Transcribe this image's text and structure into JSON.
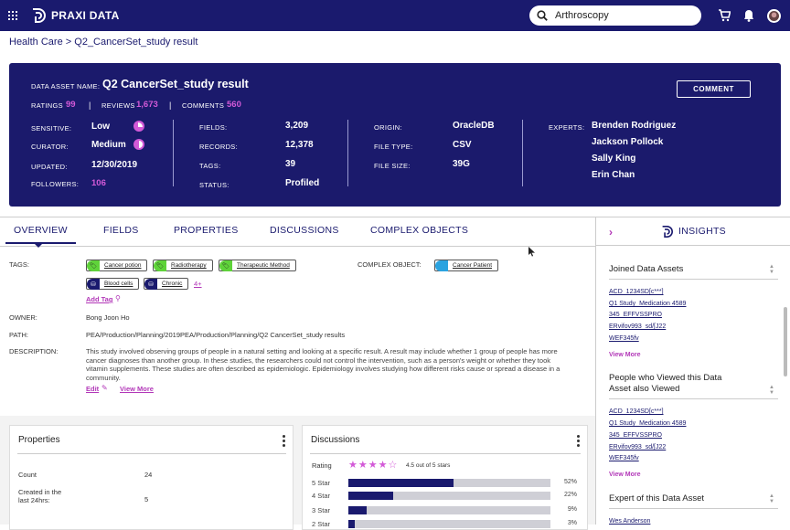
{
  "app": {
    "brand": "PRAXI DATA",
    "search_value": "Arthroscopy"
  },
  "breadcrumb": {
    "root": "Health Care",
    "sep": ">",
    "current": "Q2_CancerSet_study result"
  },
  "asset": {
    "name_label": "DATA ASSET NAME:",
    "name": "Q2 CancerSet_study result",
    "ratings_label": "RATINGS",
    "ratings": "99",
    "reviews_label": "REVIEWS",
    "reviews": "1,673",
    "comments_label": "COMMENTS",
    "comments": "560",
    "sep": "|",
    "comment_button": "COMMENT",
    "col1": {
      "sensitive_label": "SENSITIVE:",
      "sensitive": "Low",
      "curator_label": "CURATOR:",
      "curator": "Medium",
      "updated_label": "UPDATED:",
      "updated": "12/30/2019",
      "followers_label": "FOLLOWERS:",
      "followers": "106"
    },
    "col2": {
      "fields_label": "FIELDS:",
      "fields": "3,209",
      "records_label": "RECORDS:",
      "records": "12,378",
      "tags_label": "TAGS:",
      "tags": "39",
      "status_label": "STATUS:",
      "status": "Profiled"
    },
    "col3": {
      "origin_label": "ORIGIN:",
      "origin": "OracleDB",
      "filetype_label": "FILE TYPE:",
      "filetype": "CSV",
      "filesize_label": "FILE SIZE:",
      "filesize": "39G"
    },
    "experts_label": "EXPERTS:",
    "experts": [
      "Brenden Rodriguez",
      "Jackson Pollock",
      "Sally King",
      "Erin Chan"
    ]
  },
  "tabs": [
    "OVERVIEW",
    "FIELDS",
    "PROPERTIES",
    "DISCUSSIONS",
    "COMPLEX OBJECTS"
  ],
  "overview": {
    "tags_label": "TAGS:",
    "tags": [
      "Cancer potion",
      "Radiotherapy",
      "Therapeutic Method",
      "Blood cells",
      "Chronic"
    ],
    "tags_more": "4+",
    "add_tag": "Add Tag",
    "complex_label": "COMPLEX OBJECT:",
    "complex_object": "Cancer Patient",
    "owner_label": "OWNER:",
    "owner": "Bong Joon Ho",
    "path_label": "PATH:",
    "path": "PEA/Production/Planning/2019PEA/Production/Planning/Q2 CancerSet_study results",
    "description_label": "DESCRIPTION:",
    "description": "This study involved observing groups of people in a natural setting and looking at a specific result. A result may include whether 1 group of people has more cancer diagnoses than another group. In these studies, the researchers could not control the intervention, such as a person's weight or whether they took vitamin supplements. These studies are often described as epidemiologic. Epidemiology involves studying how different risks cause or spread a disease in a community.",
    "edit": "Edit",
    "view_more": "View More"
  },
  "properties_card": {
    "title": "Properties",
    "count_label": "Count",
    "count": "24",
    "created_label": "Created in the last 24hrs:",
    "created": "5"
  },
  "discussions_card": {
    "title": "Discussions",
    "rating_label": "Rating",
    "rating_text": "4.5 out of  5 stars",
    "rating_value": 4.5,
    "bars": [
      {
        "label": "5 Star",
        "pct": "52%",
        "value": 52
      },
      {
        "label": "4 Star",
        "pct": "22%",
        "value": 22
      },
      {
        "label": "3 Star",
        "pct": "9%",
        "value": 9
      },
      {
        "label": "2 Star",
        "pct": "3%",
        "value": 3
      }
    ]
  },
  "insights": {
    "title": "INSIGHTS",
    "joined_title": "Joined Data Assets",
    "joined": [
      "ACD_1234SD[c***]",
      "Q1 Study_Medication 4589",
      "345_EFFVSSPRO",
      "ERvifov993_sd/[J22",
      "WEF345fv"
    ],
    "viewed_title": "People who Viewed this Data Asset also Viewed",
    "viewed": [
      "ACD_1234SD[c***]",
      "Q1 Study_Medication 4589",
      "345_EFFVSSPRO",
      "ERvifov993_sd/[J22",
      "WEF345fv"
    ],
    "view_more": "View More",
    "expert_title": "Expert of this Data Asset",
    "expert": "Wes Anderson"
  },
  "colors": {
    "navy": "#1a1a6e",
    "accent": "#d35ad8",
    "tag_green": "#5fd33a",
    "complex_blue": "#2aa3e0"
  }
}
